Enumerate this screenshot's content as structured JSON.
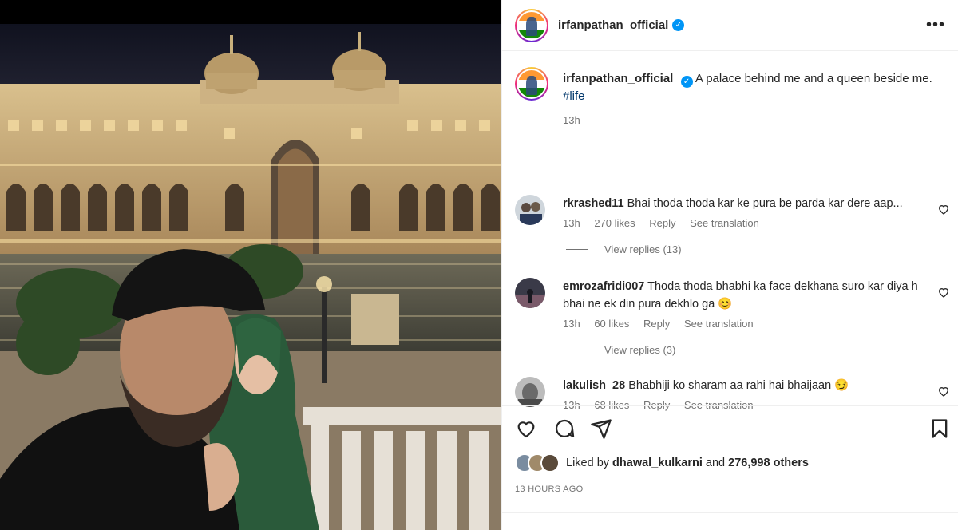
{
  "post": {
    "username": "irfanpathan_official",
    "verified_mark": "✓",
    "more_label": "•••",
    "caption_text": "A palace behind me and a queen beside me.",
    "hashtag": "#life",
    "caption_time": "13h"
  },
  "comments": [
    {
      "username": "rkrashed11",
      "text": "Bhai thoda thoda kar ke pura be parda kar dere aap...",
      "time": "13h",
      "likes": "270 likes",
      "reply": "Reply",
      "translate": "See translation",
      "view_replies": "View replies (13)",
      "avatar_color": "#7a8a9a"
    },
    {
      "username": "emrozafridi007",
      "text": "Thoda thoda bhabhi ka face dekhana suro kar diya h bhai ne ek din pura dekhlo ga",
      "emoji": "😊",
      "time": "13h",
      "likes": "60 likes",
      "reply": "Reply",
      "translate": "See translation",
      "view_replies": "View replies (3)",
      "avatar_color": "#3a3a4a"
    },
    {
      "username": "lakulish_28",
      "text": "Bhabhiji ko sharam aa rahi hai bhaijaan",
      "emoji": "😏",
      "time": "13h",
      "likes": "68 likes",
      "reply": "Reply",
      "translate": "See translation",
      "avatar_color": "#9a9a9a"
    }
  ],
  "liked_by": {
    "prefix": "Liked by",
    "user": "dhawal_kulkarni",
    "and": "and",
    "others": "276,998 others"
  },
  "timestamp": "13 HOURS AGO",
  "colors": {
    "link": "#00376b",
    "muted": "#737373",
    "verified": "#0095f6",
    "text": "#262626"
  },
  "icons": [
    "more-options-icon",
    "verified-icon",
    "heart-icon",
    "comment-icon",
    "share-icon",
    "bookmark-icon"
  ]
}
